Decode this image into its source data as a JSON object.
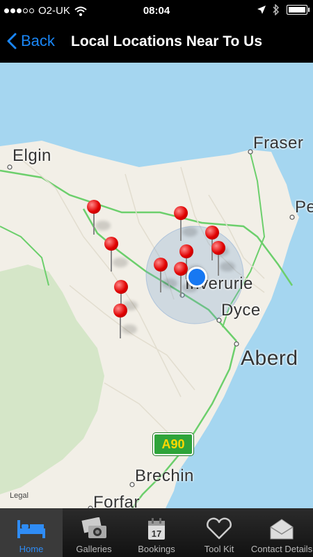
{
  "status_bar": {
    "carrier": "O2-UK",
    "time": "08:04"
  },
  "nav": {
    "back_label": "Back",
    "title": "Local Locations Near To Us"
  },
  "map": {
    "labels": {
      "elgin": "Elgin",
      "fraser": "Fraser",
      "pe": "Pe",
      "inverurie": "Inverurie",
      "dyce": "Dyce",
      "aberd": "Aberd",
      "brechin": "Brechin",
      "forfar": "Forfar"
    },
    "road_shield": "A90",
    "legal": "Legal"
  },
  "tabs": [
    {
      "label": "Home",
      "icon": "bed-icon",
      "active": true
    },
    {
      "label": "Galleries",
      "icon": "camera-icon",
      "active": false
    },
    {
      "label": "Bookings",
      "icon": "calendar-icon",
      "active": false
    },
    {
      "label": "Tool Kit",
      "icon": "heart-icon",
      "active": false
    },
    {
      "label": "Contact Details",
      "icon": "envelope-icon",
      "active": false
    }
  ],
  "calendar_day": "17",
  "colors": {
    "accent": "#1a86f5",
    "sea": "#a5d6f0",
    "land": "#f2efe7",
    "pin": "#e00000"
  }
}
